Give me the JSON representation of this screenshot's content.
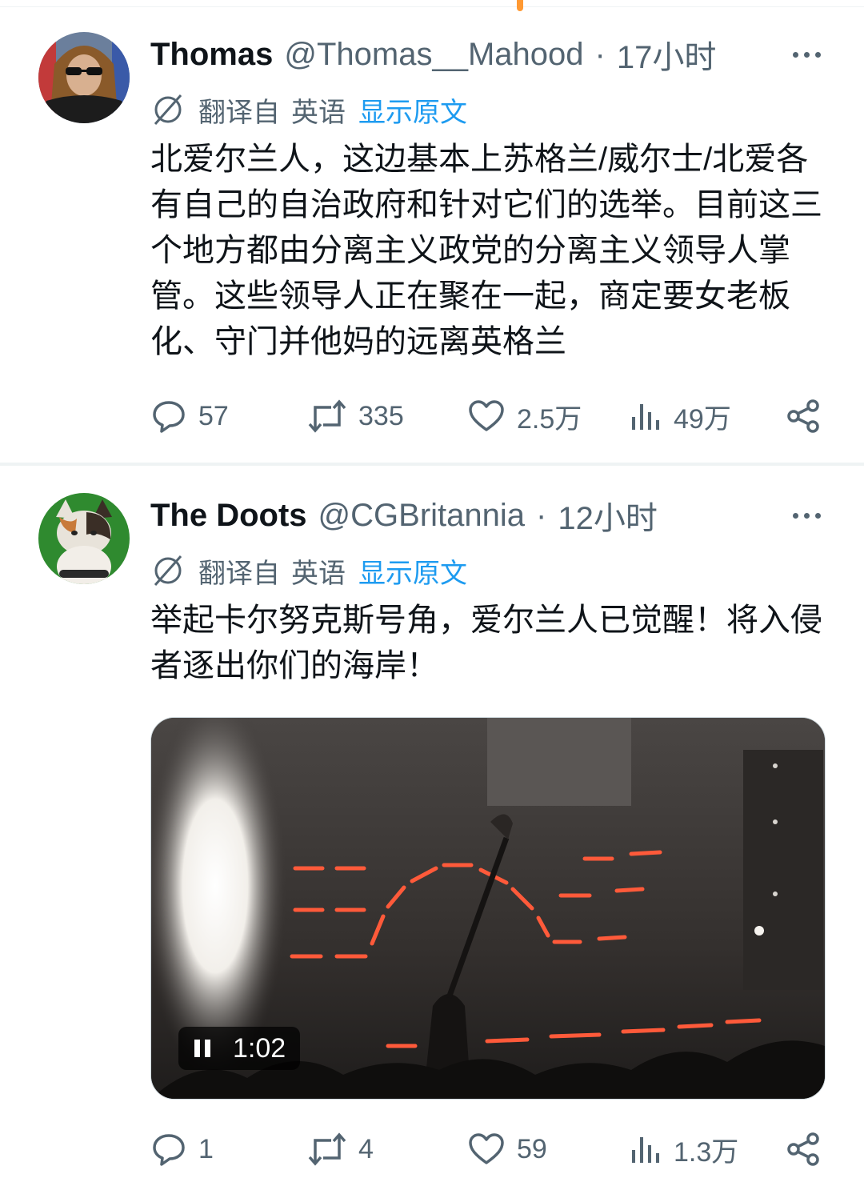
{
  "tweets": [
    {
      "name": "Thomas",
      "handle": "@Thomas__Mahood",
      "time": "17小时",
      "translation": {
        "label": "翻译自",
        "language": "英语",
        "show_original": "显示原文"
      },
      "text": "北爱尔兰人，这边基本上苏格兰/威尔士/北爱各有自己的自治政府和针对它们的选举。目前这三个地方都由分离主义政党的分离主义领导人掌管。这些领导人正在聚在一起，商定要女老板化、守门并他妈的远离英格兰",
      "stats": {
        "replies": "57",
        "retweets": "335",
        "likes": "2.5万",
        "views": "49万"
      }
    },
    {
      "name": "The Doots",
      "handle": "@CGBritannia",
      "time": "12小时",
      "translation": {
        "label": "翻译自",
        "language": "英语",
        "show_original": "显示原文"
      },
      "text": "举起卡尔努克斯号角，爱尔兰人已觉醒！将入侵者逐出你们的海岸！",
      "video": {
        "duration": "1:02"
      },
      "stats": {
        "replies": "1",
        "retweets": "4",
        "likes": "59",
        "views": "1.3万"
      }
    }
  ],
  "colors": {
    "text": "#0f1419",
    "muted": "#536471",
    "link": "#1d9bf0",
    "divider": "#eff3f4"
  },
  "icons": [
    "more-icon",
    "translate-icon",
    "reply-icon",
    "retweet-icon",
    "like-icon",
    "views-icon",
    "share-icon",
    "pause-icon"
  ]
}
